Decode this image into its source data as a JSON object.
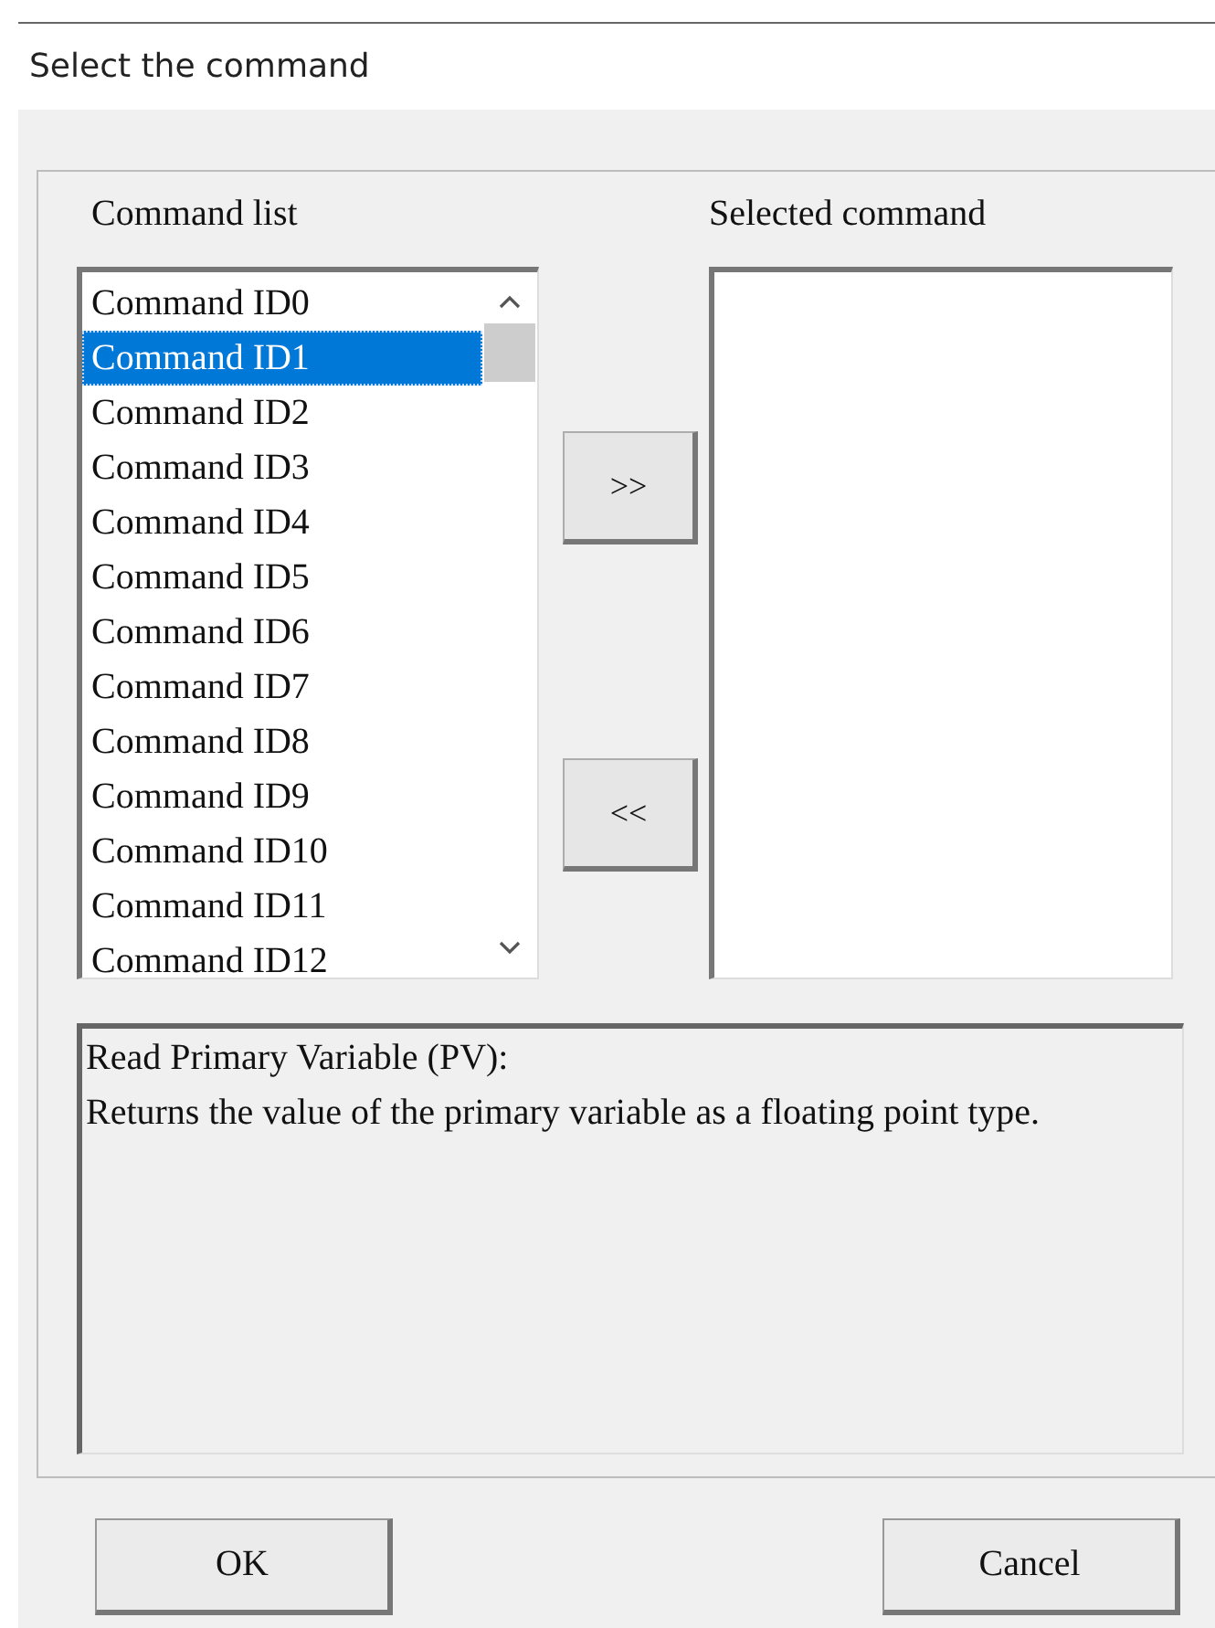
{
  "window": {
    "title": "Select the command"
  },
  "command_list": {
    "label": "Command list",
    "items": [
      {
        "label": "Command ID0",
        "selected": false
      },
      {
        "label": "Command ID1",
        "selected": true
      },
      {
        "label": "Command ID2",
        "selected": false
      },
      {
        "label": "Command ID3",
        "selected": false
      },
      {
        "label": "Command ID4",
        "selected": false
      },
      {
        "label": "Command ID5",
        "selected": false
      },
      {
        "label": "Command ID6",
        "selected": false
      },
      {
        "label": "Command ID7",
        "selected": false
      },
      {
        "label": "Command ID8",
        "selected": false
      },
      {
        "label": "Command ID9",
        "selected": false
      },
      {
        "label": "Command ID10",
        "selected": false
      },
      {
        "label": "Command ID11",
        "selected": false
      },
      {
        "label": "Command ID12",
        "selected": false
      }
    ]
  },
  "move_buttons": [
    ">>",
    "<<"
  ],
  "selected_command": {
    "label": "Selected command"
  },
  "description": [
    "Read Primary Variable (PV):",
    "Returns the value of the primary variable as a floating point type."
  ],
  "buttons": [
    "OK",
    "Cancel"
  ]
}
